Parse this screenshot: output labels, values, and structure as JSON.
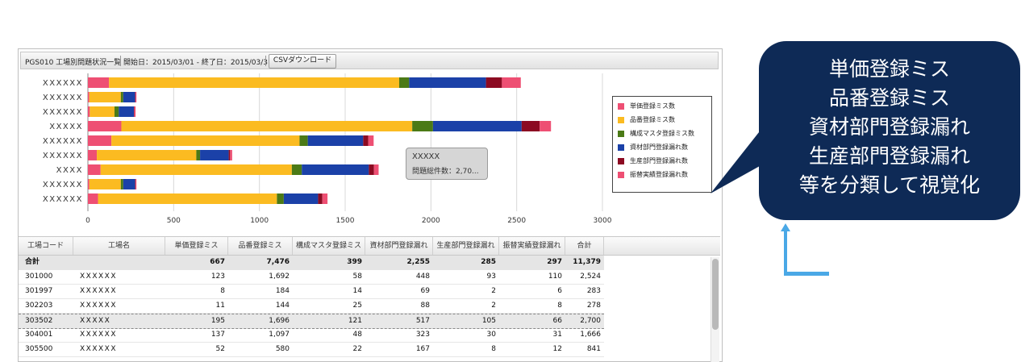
{
  "toolbar": {
    "title": "PGS010 工場別問題状況一覧",
    "range": "開始日：2015/03/01 - 終了日：2015/03/31",
    "csv_button": "CSVダウンロード"
  },
  "chart_data": {
    "type": "bar",
    "orientation": "horizontal",
    "stacked": true,
    "categories": [
      "XXXXXX",
      "XXXXXX",
      "XXXXXX",
      "XXXXX",
      "XXXXXX",
      "XXXXXX",
      "XXXX",
      "XXXXXX",
      "XXXXXX"
    ],
    "series": [
      {
        "name": "単価登録ミス数",
        "color": "#ee4f73",
        "values": [
          123,
          8,
          11,
          195,
          137,
          52,
          74,
          8,
          59
        ]
      },
      {
        "name": "品番登録ミス数",
        "color": "#fbbb21",
        "values": [
          1692,
          184,
          144,
          1696,
          1097,
          580,
          1115,
          184,
          1043
        ]
      },
      {
        "name": "構成マスタ登録ミス数",
        "color": "#4b7a16",
        "values": [
          58,
          14,
          25,
          121,
          48,
          22,
          58,
          14,
          40
        ]
      },
      {
        "name": "資材部門登録漏れ数",
        "color": "#1b41a8",
        "values": [
          448,
          69,
          88,
          517,
          323,
          167,
          391,
          69,
          200
        ]
      },
      {
        "name": "生産部門登録漏れ数",
        "color": "#8c0a22",
        "values": [
          93,
          2,
          2,
          105,
          30,
          8,
          30,
          2,
          25
        ]
      },
      {
        "name": "振替実績登録漏れ数",
        "color": "#ee4f73",
        "values": [
          110,
          6,
          8,
          66,
          31,
          12,
          27,
          6,
          30
        ]
      }
    ],
    "xlim": [
      0,
      3000
    ],
    "xticks": [
      "0",
      "500",
      "1000",
      "1500",
      "2000",
      "2500",
      "3000"
    ],
    "grid": true,
    "legend_position": "right"
  },
  "tooltip": {
    "name": "XXXXX",
    "value": "問題総件数：2,70..."
  },
  "table": {
    "headers": [
      "工場コード",
      "工場名",
      "単価登録ミス",
      "品番登録ミス",
      "構成マスタ登録ミス",
      "資材部門登録漏れ",
      "生産部門登録漏れ",
      "振替実績登録漏れ",
      "合計"
    ],
    "total": [
      "合計",
      "",
      "667",
      "7,476",
      "399",
      "2,255",
      "285",
      "297",
      "11,379"
    ],
    "rows": [
      [
        "301000",
        "XXXXXX",
        "123",
        "1,692",
        "58",
        "448",
        "93",
        "110",
        "2,524"
      ],
      [
        "301997",
        "XXXXXX",
        "8",
        "184",
        "14",
        "69",
        "2",
        "6",
        "283"
      ],
      [
        "302203",
        "XXXXXX",
        "11",
        "144",
        "25",
        "88",
        "2",
        "8",
        "278"
      ],
      [
        "303502",
        "XXXXX",
        "195",
        "1,696",
        "121",
        "517",
        "105",
        "66",
        "2,700"
      ],
      [
        "304001",
        "XXXXXX",
        "137",
        "1,097",
        "48",
        "323",
        "30",
        "31",
        "1,666"
      ],
      [
        "305500",
        "XXXXXX",
        "52",
        "580",
        "22",
        "167",
        "8",
        "12",
        "841"
      ]
    ],
    "selected_row": 3
  },
  "callout": {
    "lines": [
      "単価登録ミス",
      "品番登録ミス",
      "資材部門登録漏れ",
      "生産部門登録漏れ",
      "等を分類して視覚化"
    ],
    "color": "#0e2a56",
    "arrow_color": "#4aa8e6"
  }
}
